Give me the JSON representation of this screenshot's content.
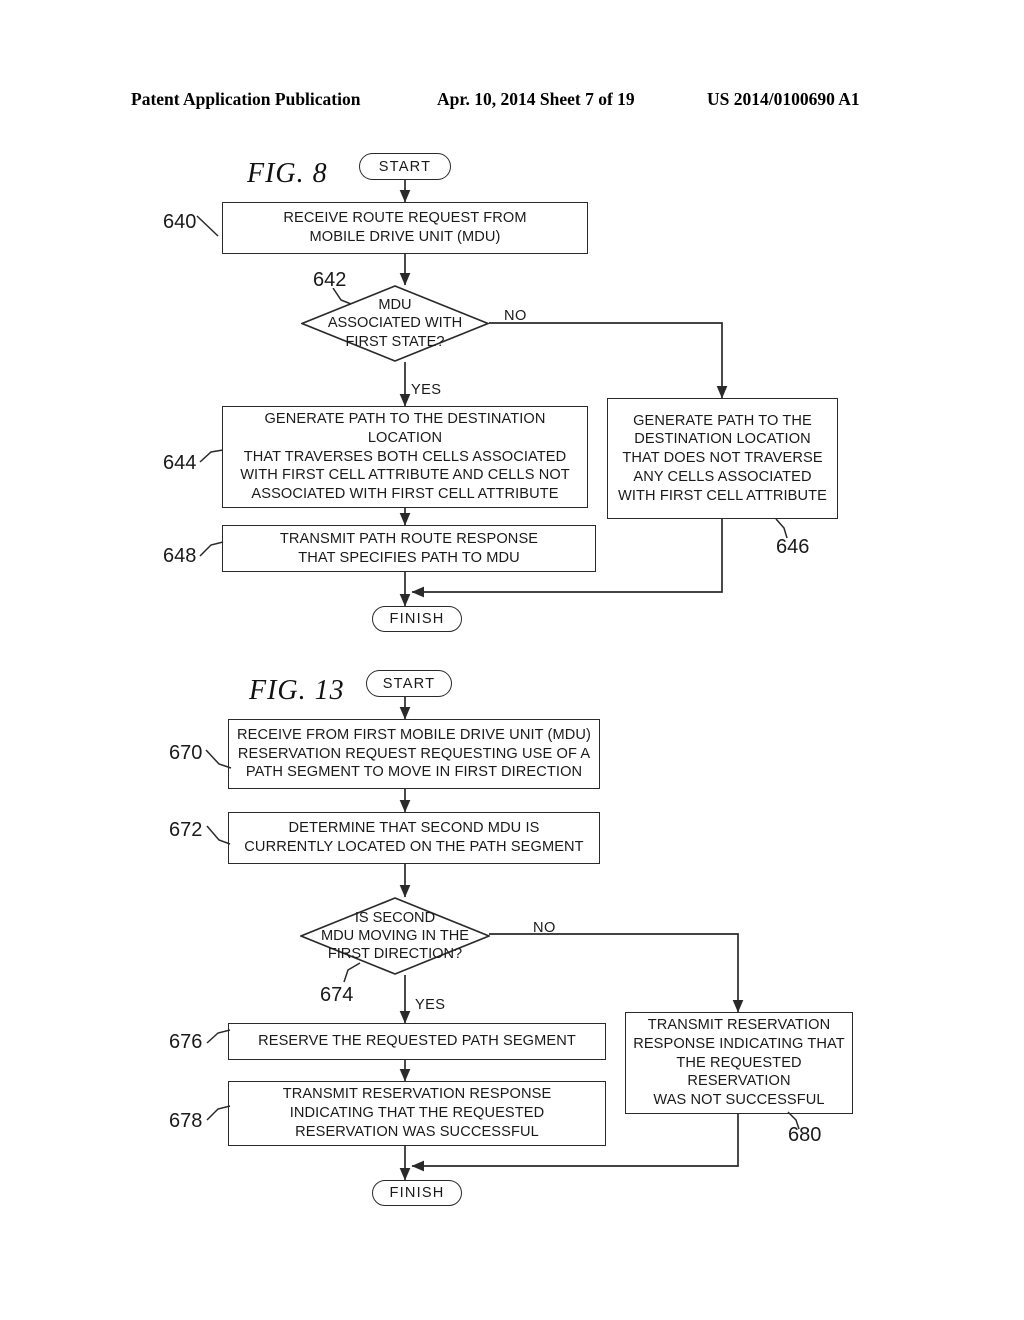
{
  "header": {
    "left": "Patent Application Publication",
    "middle": "Apr. 10, 2014  Sheet 7 of 19",
    "right": "US 2014/0100690 A1"
  },
  "figures": [
    {
      "id": "fig8",
      "title": "FIG. 8",
      "start_label": "START",
      "finish_label": "FINISH",
      "nodes": {
        "n640": {
          "ref": "640",
          "lines": [
            "RECEIVE ROUTE REQUEST FROM",
            "MOBILE DRIVE UNIT (MDU)"
          ]
        },
        "n642": {
          "ref": "642",
          "lines": [
            "MDU",
            "ASSOCIATED WITH",
            "FIRST STATE?"
          ],
          "yes_label": "YES",
          "no_label": "NO"
        },
        "n644": {
          "ref": "644",
          "lines": [
            "GENERATE PATH TO THE DESTINATION LOCATION",
            "THAT TRAVERSES BOTH CELLS ASSOCIATED",
            "WITH FIRST CELL ATTRIBUTE AND CELLS NOT",
            "ASSOCIATED WITH FIRST CELL ATTRIBUTE"
          ]
        },
        "n646": {
          "ref": "646",
          "lines": [
            "GENERATE PATH TO THE",
            "DESTINATION LOCATION",
            "THAT DOES NOT TRAVERSE",
            "ANY CELLS ASSOCIATED",
            "WITH FIRST CELL ATTRIBUTE"
          ]
        },
        "n648": {
          "ref": "648",
          "lines": [
            "TRANSMIT PATH ROUTE RESPONSE",
            "THAT SPECIFIES PATH TO MDU"
          ]
        }
      }
    },
    {
      "id": "fig13",
      "title": "FIG. 13",
      "start_label": "START",
      "finish_label": "FINISH",
      "nodes": {
        "n670": {
          "ref": "670",
          "lines": [
            "RECEIVE FROM FIRST MOBILE DRIVE UNIT (MDU)",
            "RESERVATION REQUEST REQUESTING USE OF A",
            "PATH SEGMENT TO MOVE IN FIRST DIRECTION"
          ]
        },
        "n672": {
          "ref": "672",
          "lines": [
            "DETERMINE THAT SECOND MDU IS",
            "CURRENTLY LOCATED ON THE PATH SEGMENT"
          ]
        },
        "n674": {
          "ref": "674",
          "lines": [
            "IS SECOND",
            "MDU MOVING IN THE",
            "FIRST DIRECTION?"
          ],
          "yes_label": "YES",
          "no_label": "NO"
        },
        "n676": {
          "ref": "676",
          "lines": [
            "RESERVE THE REQUESTED PATH SEGMENT"
          ]
        },
        "n678": {
          "ref": "678",
          "lines": [
            "TRANSMIT RESERVATION RESPONSE",
            "INDICATING THAT THE REQUESTED",
            "RESERVATION WAS SUCCESSFUL"
          ]
        },
        "n680": {
          "ref": "680",
          "lines": [
            "TRANSMIT RESERVATION",
            "RESPONSE INDICATING THAT",
            "THE REQUESTED RESERVATION",
            "WAS NOT SUCCESSFUL"
          ]
        }
      }
    }
  ],
  "colors": {
    "ink": "#1a1a1a",
    "line": "#2a2a2a",
    "paper": "#ffffff"
  }
}
